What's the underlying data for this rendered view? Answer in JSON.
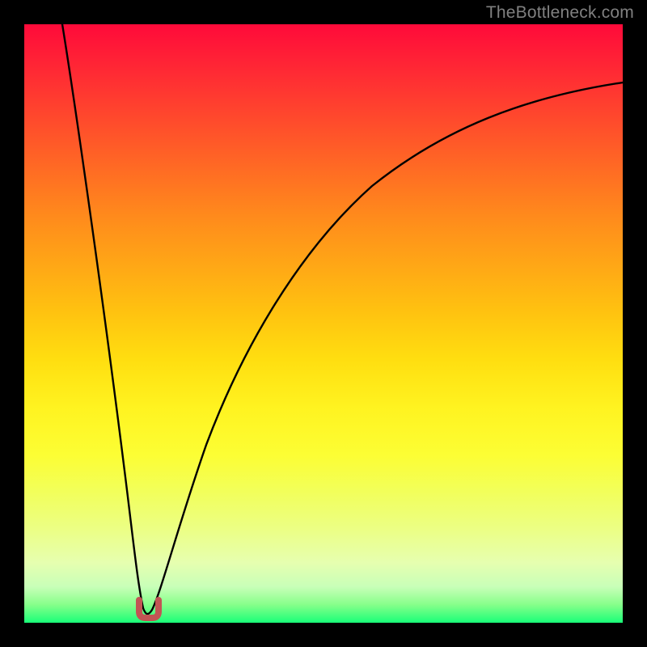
{
  "watermark": "TheBottleneck.com",
  "colors": {
    "background": "#000000",
    "gradient_top": "#ff0a3a",
    "gradient_bottom": "#19ff78",
    "curve": "#000000",
    "marker": "#c25454"
  },
  "chart_data": {
    "type": "line",
    "title": "",
    "xlabel": "",
    "ylabel": "",
    "xlim": [
      0,
      100
    ],
    "ylim": [
      0,
      100
    ],
    "grid": false,
    "legend": false,
    "series": [
      {
        "name": "bottleneck-curve",
        "x": [
          0,
          2,
          4,
          6,
          8,
          10,
          12,
          14,
          16,
          18,
          19.5,
          21,
          23,
          25,
          28,
          32,
          36,
          40,
          45,
          50,
          55,
          60,
          65,
          70,
          75,
          80,
          85,
          90,
          95,
          100
        ],
        "y": [
          100,
          90,
          80,
          70,
          60,
          50,
          40,
          30,
          20,
          10,
          2,
          2,
          10,
          20,
          34,
          47,
          55,
          61,
          67,
          72,
          75,
          78,
          80,
          82,
          84,
          85.5,
          87,
          88,
          89,
          90
        ]
      }
    ],
    "annotations": [
      {
        "name": "optimal-marker",
        "shape": "u-bracket",
        "x": 20,
        "y": 2,
        "color": "#c25454"
      }
    ],
    "background_gradient": {
      "direction": "vertical",
      "stops": [
        {
          "pos": 0,
          "color": "#ff0a3a"
        },
        {
          "pos": 50,
          "color": "#ffd810"
        },
        {
          "pos": 80,
          "color": "#f6ff50"
        },
        {
          "pos": 100,
          "color": "#19ff78"
        }
      ]
    }
  }
}
